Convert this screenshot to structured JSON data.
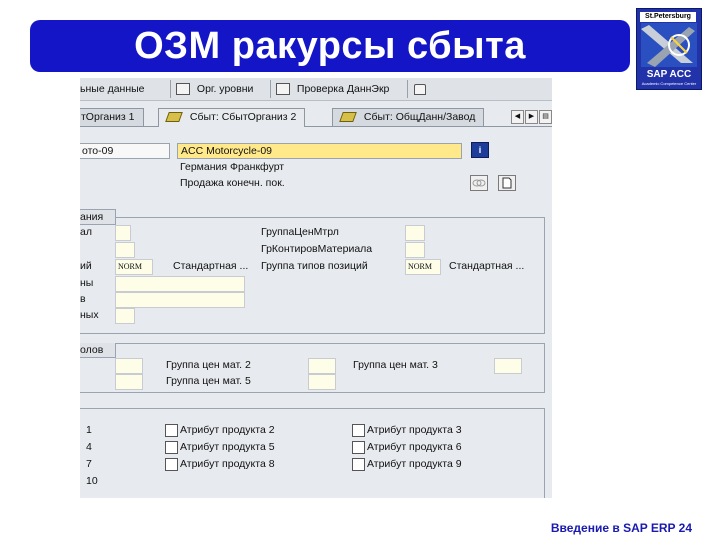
{
  "slide": {
    "title": "ОЗМ ракурсы сбыта",
    "footer": "Введение в SAP ERP  24",
    "logo": {
      "top": "St.Petersburg",
      "brand": "SAP  ACC",
      "sub": "Academic Competence Center"
    }
  },
  "toolbar": {
    "btn1": "ьные данные",
    "btn2": "Орг. уровни",
    "btn3": "Проверка ДаннЭкр"
  },
  "tabs": {
    "t1": "тОрганиз 1",
    "t2": "Сбыт: СбытОрганиз 2",
    "t3": "Сбыт: ОбщДанн/Завод"
  },
  "header": {
    "material_no": "ото-09",
    "material_desc": "ACC Motorcycle-09",
    "org1": "Германия Франкфурт",
    "org2": "Продажа конечн. пок."
  },
  "group1": {
    "title": "ания",
    "r1_left": "ал",
    "r3_left": "ий",
    "r3_value": "NORM",
    "r3_text": "Стандартная ...",
    "r4_left": "ны",
    "r5_left": "в",
    "r6_left": "ных",
    "r1_mid": "ГруппаЦенМтрл",
    "r2_mid": "ГрКонтировМатериала",
    "r3_mid": "Группа типов позиций",
    "r3_mid_value": "NORM",
    "r3_mid_text": "Стандартная ..."
  },
  "group2": {
    "title": "олов",
    "l1": "Группа цен мат. 2",
    "l2": "Группа цен мат. 3",
    "l3": "Группа цен мат. 5"
  },
  "group3": {
    "row1_left": "1",
    "row2_left": "4",
    "row3_left": "7",
    "row4_left": "10",
    "a2": "Атрибут продукта 2",
    "a3": "Атрибут продукта 3",
    "a5": "Атрибут продукта 5",
    "a6": "Атрибут продукта 6",
    "a8": "Атрибут продукта 8",
    "a9": "Атрибут продукта 9"
  },
  "colors": {
    "title_bar": "#1515c8",
    "footer": "#1a1ab0",
    "highlight": "#ffe98a"
  }
}
